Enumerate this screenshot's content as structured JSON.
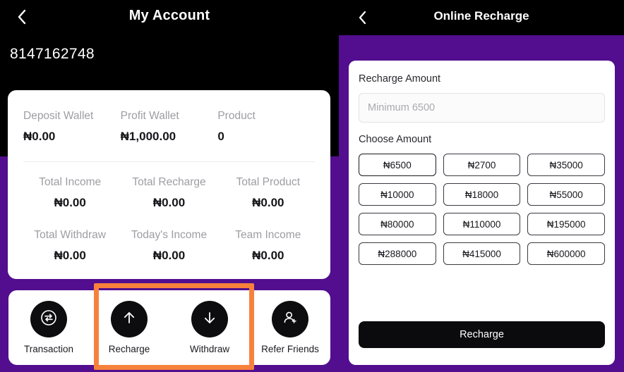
{
  "left_panel": {
    "header": {
      "title": "My Account",
      "back_icon": "chevron-left-icon"
    },
    "account_number": "8147162748",
    "wallet_card": {
      "primary": [
        {
          "label": "Deposit Wallet",
          "value": "₦0.00"
        },
        {
          "label": "Profit Wallet",
          "value": "₦1,000.00"
        },
        {
          "label": "Product",
          "value": "0"
        }
      ],
      "stats": [
        {
          "label": "Total Income",
          "value": "₦0.00"
        },
        {
          "label": "Total Recharge",
          "value": "₦0.00"
        },
        {
          "label": "Total Product",
          "value": "₦0.00"
        },
        {
          "label": "Total Withdraw",
          "value": "₦0.00"
        },
        {
          "label": "Today's Income",
          "value": "₦0.00"
        },
        {
          "label": "Team Income",
          "value": "₦0.00"
        }
      ]
    },
    "actions": [
      {
        "label": "Transaction",
        "icon": "transfer-arrows-circle-icon"
      },
      {
        "label": "Recharge",
        "icon": "arrow-up-icon"
      },
      {
        "label": "Withdraw",
        "icon": "arrow-down-icon"
      },
      {
        "label": "Refer Friends",
        "icon": "person-add-icon"
      }
    ],
    "highlight": {
      "color": "#F7813C"
    }
  },
  "right_panel": {
    "header": {
      "title": "Online Recharge",
      "back_icon": "chevron-left-icon"
    },
    "recharge_amount_label": "Recharge Amount",
    "amount_input_value": "",
    "amount_input_placeholder": "Minimum 6500",
    "choose_amount_label": "Choose Amount",
    "amount_options": [
      "₦6500",
      "₦2700",
      "₦35000",
      "₦10000",
      "₦18000",
      "₦55000",
      "₦80000",
      "₦110000",
      "₦195000",
      "₦288000",
      "₦415000",
      "₦600000"
    ],
    "submit_label": "Recharge"
  },
  "theme": {
    "purple": "#520E8E",
    "black": "#000000",
    "white": "#FFFFFF",
    "orange_highlight": "#F7813C"
  }
}
